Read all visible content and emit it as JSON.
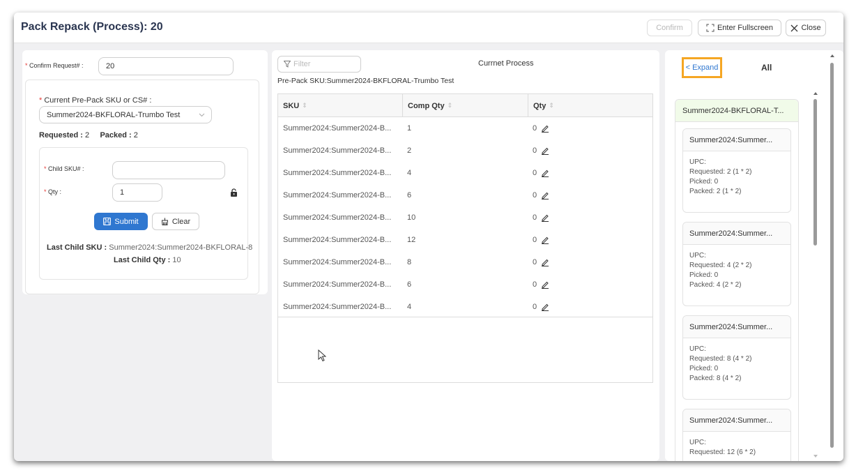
{
  "header": {
    "title": "Pack Repack (Process): 20",
    "confirm_label": "Confirm",
    "fullscreen_label": "Enter Fullscreen",
    "close_label": "Close"
  },
  "left": {
    "confirm_request_label": "Confirm Request# :",
    "confirm_request_value": "20",
    "prepack_label": "Current Pre-Pack SKU or CS# :",
    "prepack_value": "Summer2024-BKFLORAL-Trumbo Test",
    "requested_label": "Requested :",
    "requested_value": "2",
    "packed_label": "Packed :",
    "packed_value": "2",
    "child_sku_label": "Child SKU# :",
    "child_sku_value": "",
    "qty_label": "Qty :",
    "qty_value": "1",
    "submit_label": "Submit",
    "clear_label": "Clear",
    "last_child_sku_label": "Last Child SKU :",
    "last_child_sku_value": "Summer2024:Summer2024-BKFLORAL-8",
    "last_child_qty_label": "Last Child Qty :",
    "last_child_qty_value": "10"
  },
  "middle": {
    "filter_placeholder": "Filter",
    "process_title": "Currnet Process",
    "prepack_sku_line": "Pre-Pack SKU:Summer2024-BKFLORAL-Trumbo Test",
    "columns": [
      "SKU",
      "Comp Qty",
      "Qty"
    ],
    "rows": [
      {
        "sku": "Summer2024:Summer2024-B...",
        "comp_qty": "1",
        "qty": "0"
      },
      {
        "sku": "Summer2024:Summer2024-B...",
        "comp_qty": "2",
        "qty": "0"
      },
      {
        "sku": "Summer2024:Summer2024-B...",
        "comp_qty": "4",
        "qty": "0"
      },
      {
        "sku": "Summer2024:Summer2024-B...",
        "comp_qty": "6",
        "qty": "0"
      },
      {
        "sku": "Summer2024:Summer2024-B...",
        "comp_qty": "10",
        "qty": "0"
      },
      {
        "sku": "Summer2024:Summer2024-B...",
        "comp_qty": "12",
        "qty": "0"
      },
      {
        "sku": "Summer2024:Summer2024-B...",
        "comp_qty": "8",
        "qty": "0"
      },
      {
        "sku": "Summer2024:Summer2024-B...",
        "comp_qty": "6",
        "qty": "0"
      },
      {
        "sku": "Summer2024:Summer2024-B...",
        "comp_qty": "4",
        "qty": "0"
      }
    ]
  },
  "right": {
    "expand_label": "< Expand",
    "all_label": "All",
    "group_title": "Summer2024-BKFLORAL-T...",
    "cards": [
      {
        "title": "Summer2024:Summer...",
        "upc": "UPC:",
        "requested": "Requested: 2 (1 * 2)",
        "picked": "Picked: 0",
        "packed": "Packed: 2 (1 * 2)"
      },
      {
        "title": "Summer2024:Summer...",
        "upc": "UPC:",
        "requested": "Requested: 4 (2 * 2)",
        "picked": "Picked: 0",
        "packed": "Packed: 4 (2 * 2)"
      },
      {
        "title": "Summer2024:Summer...",
        "upc": "UPC:",
        "requested": "Requested: 8 (4 * 2)",
        "picked": "Picked: 0",
        "packed": "Packed: 8 (4 * 2)"
      },
      {
        "title": "Summer2024:Summer...",
        "upc": "UPC:",
        "requested": "Requested: 12 (6 * 2)",
        "picked": "",
        "packed": ""
      }
    ]
  },
  "colors": {
    "primary": "#2f77d0",
    "expand_highlight": "#f5a623",
    "group_header": "#f1fbe9",
    "required": "#e53935"
  }
}
